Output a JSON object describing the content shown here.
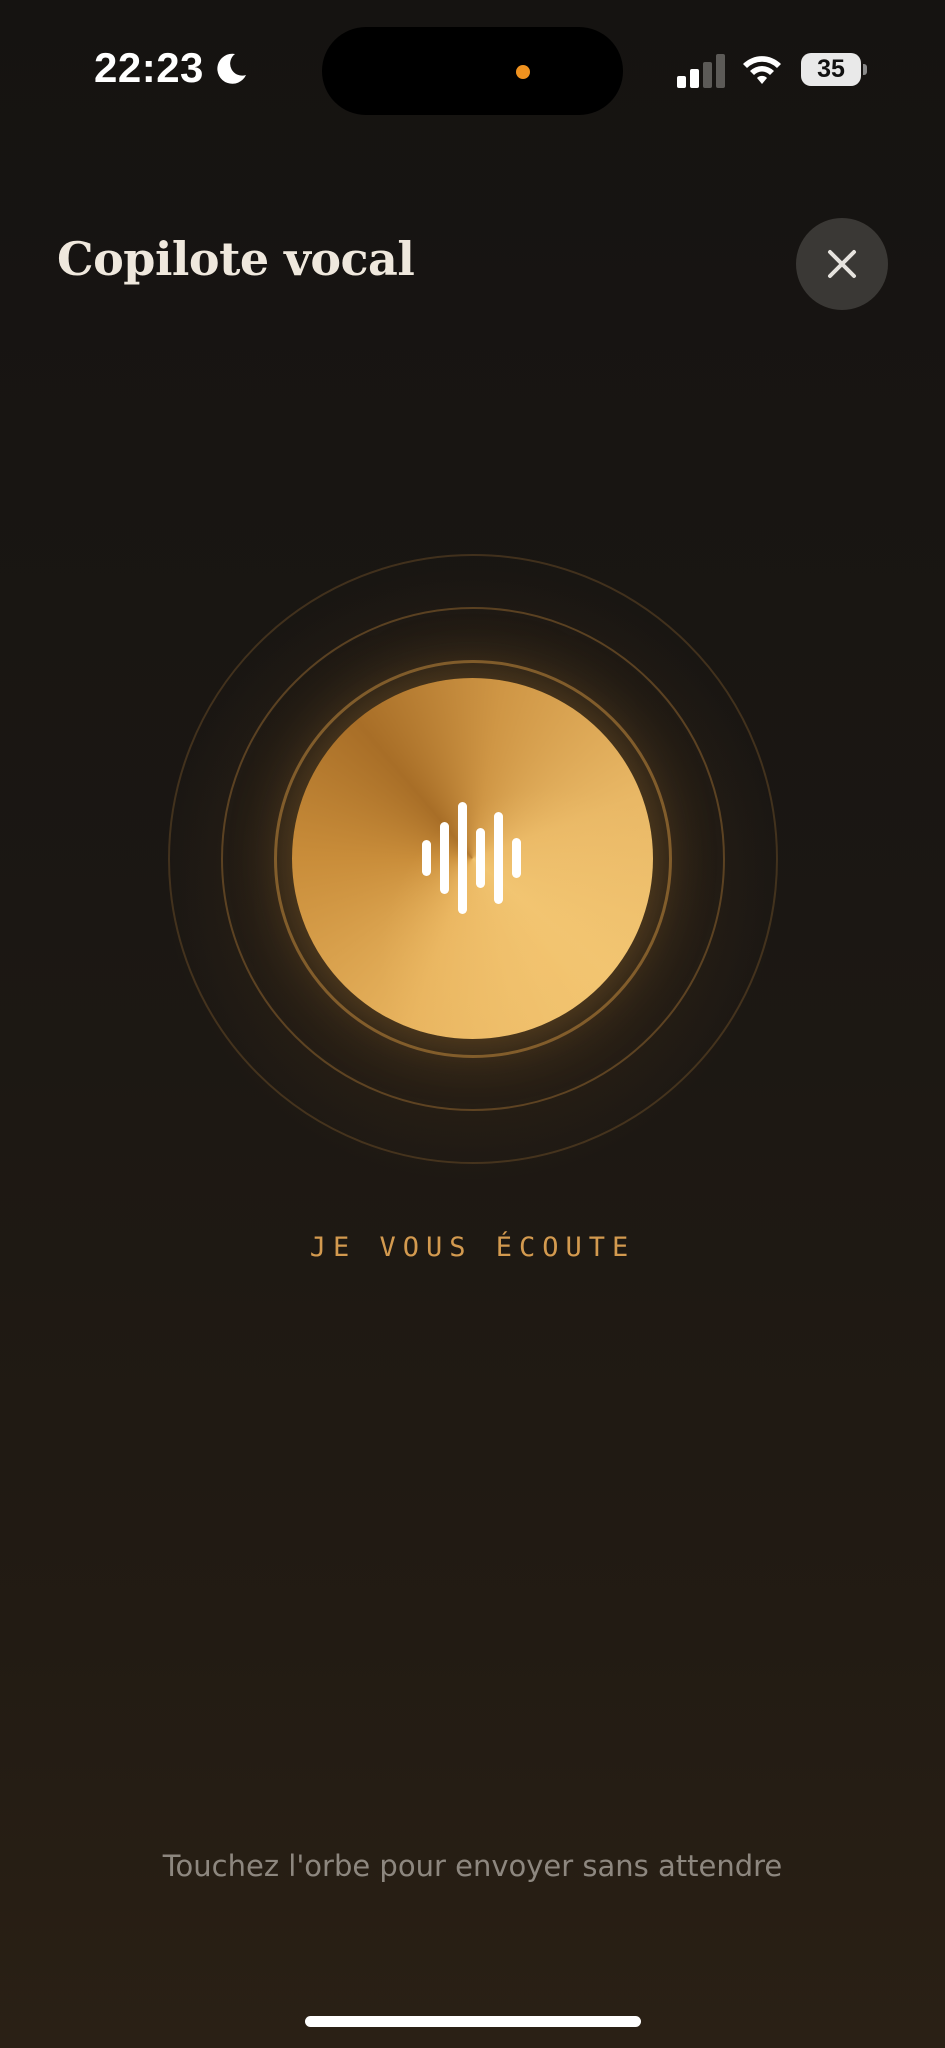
{
  "status_bar": {
    "time": "22:23",
    "battery_level": "35",
    "icons": [
      "moon-icon",
      "signal-icon",
      "wifi-icon",
      "battery-icon"
    ]
  },
  "header": {
    "title": "Copilote vocal",
    "close_icon": "close-icon"
  },
  "orb": {
    "icon": "waveform-icon",
    "status_label": "JE VOUS ÉCOUTE",
    "accent_color": "#d39a4f"
  },
  "footer": {
    "hint": "Touchez l'orbe pour envoyer sans attendre"
  },
  "colors": {
    "background": "#1b1713",
    "orb_gold": "#e8b45f",
    "island_dot": "#f0921f"
  }
}
